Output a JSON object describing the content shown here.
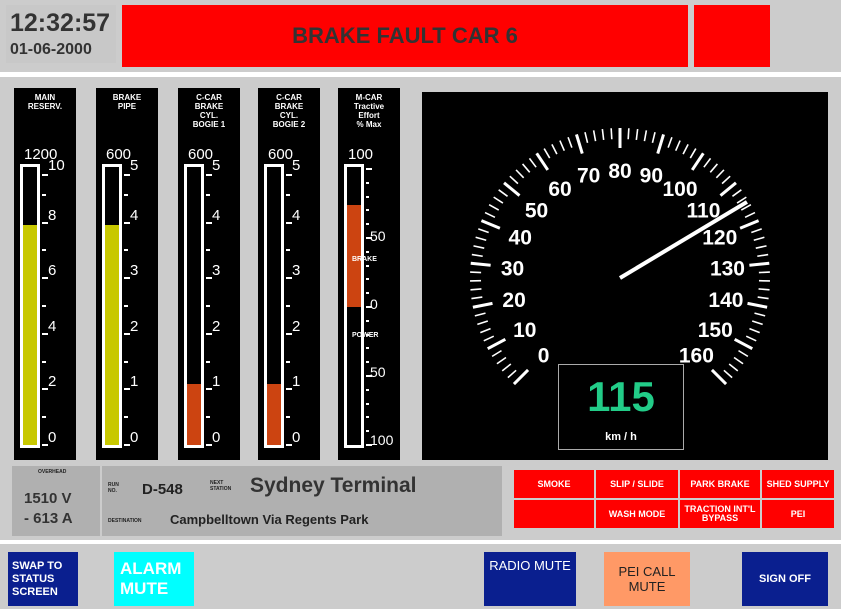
{
  "header": {
    "time": "12:32:57",
    "date": "01-06-2000",
    "alarm_message": "BRAKE FAULT CAR 6",
    "colors": {
      "alarm": "#ff0000"
    }
  },
  "gauges": [
    {
      "id": "main-reservoir",
      "title": [
        "MAIN",
        "RESERV."
      ],
      "top_label": "1200",
      "tick_labels": [
        "10",
        "8",
        "6",
        "4",
        "2",
        "0"
      ],
      "fill_percent": 0.79,
      "fill_color": "#c8c800"
    },
    {
      "id": "brake-pipe",
      "title": [
        "BRAKE",
        "PIPE"
      ],
      "top_label": "600",
      "tick_labels": [
        "5",
        "4",
        "3",
        "2",
        "1",
        "0"
      ],
      "fill_percent": 0.79,
      "fill_color": "#c8c800"
    },
    {
      "id": "c-car-bogie-1",
      "title": [
        "C-CAR",
        "BRAKE",
        "CYL.",
        "BOGIE 1"
      ],
      "top_label": "600",
      "tick_labels": [
        "5",
        "4",
        "3",
        "2",
        "1",
        "0"
      ],
      "fill_percent": 0.22,
      "fill_color": "#cc4411"
    },
    {
      "id": "c-car-bogie-2",
      "title": [
        "C-CAR",
        "BRAKE",
        "CYL.",
        "BOGIE 2"
      ],
      "top_label": "600",
      "tick_labels": [
        "5",
        "4",
        "3",
        "2",
        "1",
        "0"
      ],
      "fill_percent": 0.22,
      "fill_color": "#cc4411"
    },
    {
      "id": "m-car-tractive",
      "title": [
        "M-CAR",
        "Tractive",
        "Effort",
        "% Max"
      ],
      "top_label": "100",
      "tick_labels": [
        "50",
        "0",
        "50",
        "100"
      ],
      "mid_labels": [
        "BRAKE",
        "POWER"
      ],
      "fill_percent_from_zero": 0.35,
      "fill_color": "#cc4411"
    }
  ],
  "speedometer": {
    "speed": "115",
    "unit": "km / h",
    "speed_value": 115,
    "max": 160,
    "scale_labels": [
      "0",
      "10",
      "20",
      "30",
      "40",
      "50",
      "60",
      "70",
      "80",
      "90",
      "100",
      "110",
      "120",
      "130",
      "140",
      "150",
      "160"
    ],
    "colors": {
      "readout": "#22cc88"
    }
  },
  "power": {
    "label": "OVERHEAD",
    "voltage": "1510 V",
    "current": "- 613 A"
  },
  "trip": {
    "run_label_1": "RUN",
    "run_label_2": "NO.",
    "run_no": "D-548",
    "next_label_1": "NEXT",
    "next_label_2": "STATION",
    "next_station": "Sydney Terminal",
    "destination_label": "DESTINATION",
    "destination": "Campbelltown Via Regents Park"
  },
  "status_buttons": {
    "row1": [
      "SMOKE",
      "SLIP / SLIDE",
      "PARK BRAKE",
      "SHED SUPPLY"
    ],
    "row2": [
      "",
      "WASH MODE",
      "TRACTION INT'L BYPASS",
      "PEI"
    ],
    "colors": {
      "active": "#ff0000"
    }
  },
  "bottom_bar": {
    "swap_label": "SWAP TO STATUS SCREEN",
    "alarm_mute_label": "ALARM MUTE",
    "radio_mute_label": "RADIO MUTE",
    "pei_call_mute_label": "PEI CALL MUTE",
    "sign_off_label": "SIGN OFF",
    "colors": {
      "navy": "#0a1f8f",
      "cyan": "#00ffff",
      "orange": "#ff9966"
    }
  }
}
